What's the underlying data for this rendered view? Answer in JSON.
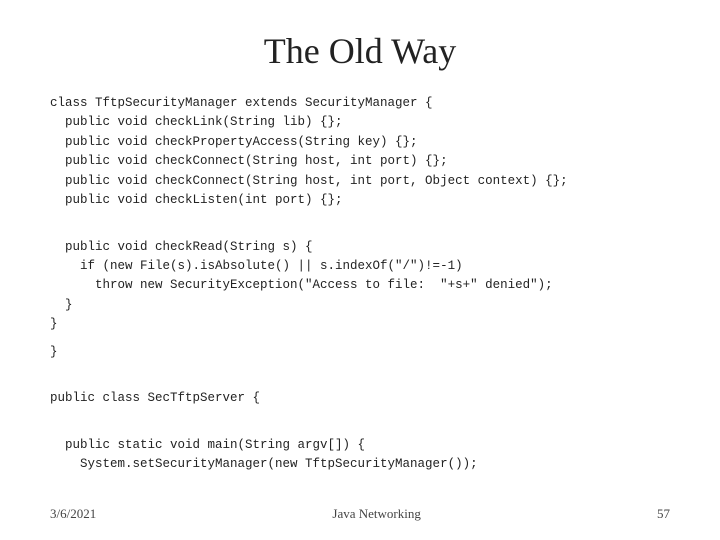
{
  "slide": {
    "title": "The Old Way",
    "code": {
      "block1": "class TftpSecurityManager extends SecurityManager {\n  public void checkLink(String lib) {};\n  public void checkPropertyAccess(String key) {};\n  public void checkConnect(String host, int port) {};\n  public void checkConnect(String host, int port, Object context) {};\n  public void checkListen(int port) {};",
      "block2": "  public void checkRead(String s) {\n    if (new File(s).isAbsolute() || s.indexOf(\"/\")!=-1)\n      throw new SecurityException(\"Access to file:  \"+s+\" denied\");\n  }\n}",
      "block3": "}",
      "block4": "public class SecTftpServer {",
      "block5": "  public static void main(String argv[]) {\n    System.setSecurityManager(new TftpSecurityManager());"
    },
    "footer": {
      "date": "3/6/2021",
      "title": "Java Networking",
      "page": "57"
    }
  }
}
